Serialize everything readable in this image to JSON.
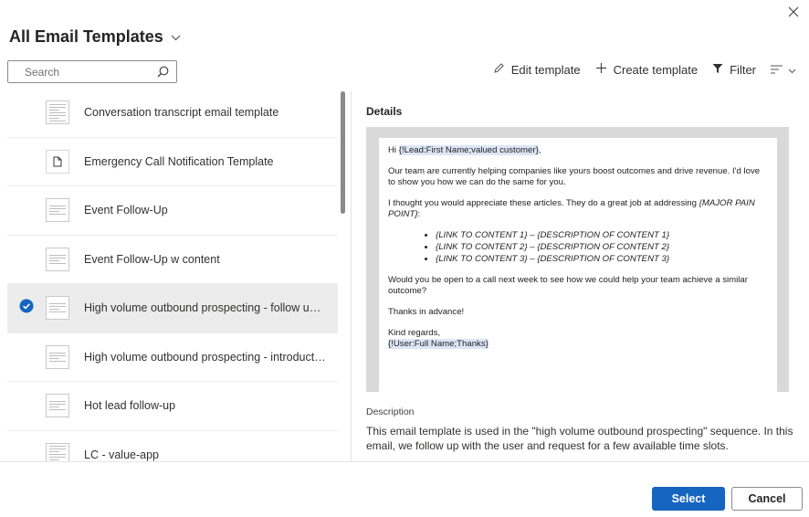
{
  "dialog": {
    "title": "All Email Templates",
    "close_icon": "close-icon"
  },
  "search": {
    "placeholder": "Search",
    "value": ""
  },
  "toolbar": {
    "edit_label": "Edit template",
    "create_label": "Create template",
    "filter_label": "Filter"
  },
  "templates": [
    {
      "label": "Conversation transcript email template",
      "thumb": "dense"
    },
    {
      "label": "Emergency Call Notification Template",
      "thumb": "doc"
    },
    {
      "label": "Event Follow-Up",
      "thumb": "lines"
    },
    {
      "label": "Event Follow-Up w content",
      "thumb": "lines"
    },
    {
      "label": "High volume outbound prospecting - follow up e...",
      "thumb": "lines",
      "selected": true
    },
    {
      "label": "High volume outbound prospecting - introductory...",
      "thumb": "lines"
    },
    {
      "label": "Hot lead follow-up",
      "thumb": "lines"
    },
    {
      "label": "LC - value-app",
      "thumb": "dense"
    }
  ],
  "details": {
    "heading": "Details",
    "preview": {
      "greeting_prefix": "Hi ",
      "greeting_token": "{!Lead:First Name;valued customer}",
      "greeting_suffix": ",",
      "para1": "Our team are currently helping companies like yours boost outcomes and drive revenue. I'd love to show you how we can do the same for you.",
      "para2_prefix": "I thought you would appreciate these articles. They do a great job at addressing ",
      "para2_token": "{MAJOR PAIN POINT}",
      "para2_suffix": ":",
      "bullets": [
        "{LINK TO CONTENT 1} – {DESCRIPTION OF CONTENT 1}",
        "{LINK TO CONTENT 2} – {DESCRIPTION OF CONTENT 2}",
        "{LINK TO CONTENT 3} – {DESCRIPTION OF CONTENT 3}"
      ],
      "para3": "Would you be open to a call next week to see how we could help your team achieve a similar outcome?",
      "para4": "Thanks in advance!",
      "signoff": "Kind regards,",
      "signature_token": "{!User:Full Name;Thanks}"
    },
    "description_label": "Description",
    "description_text": "This email template is used in the \"high volume outbound prospecting\" sequence. In this email, we follow up with the user and request for a few available time slots."
  },
  "footer": {
    "select_label": "Select",
    "cancel_label": "Cancel"
  },
  "colors": {
    "accent": "#1565c0",
    "selected_row": "#ececec",
    "token_highlight": "#dce6f5"
  }
}
